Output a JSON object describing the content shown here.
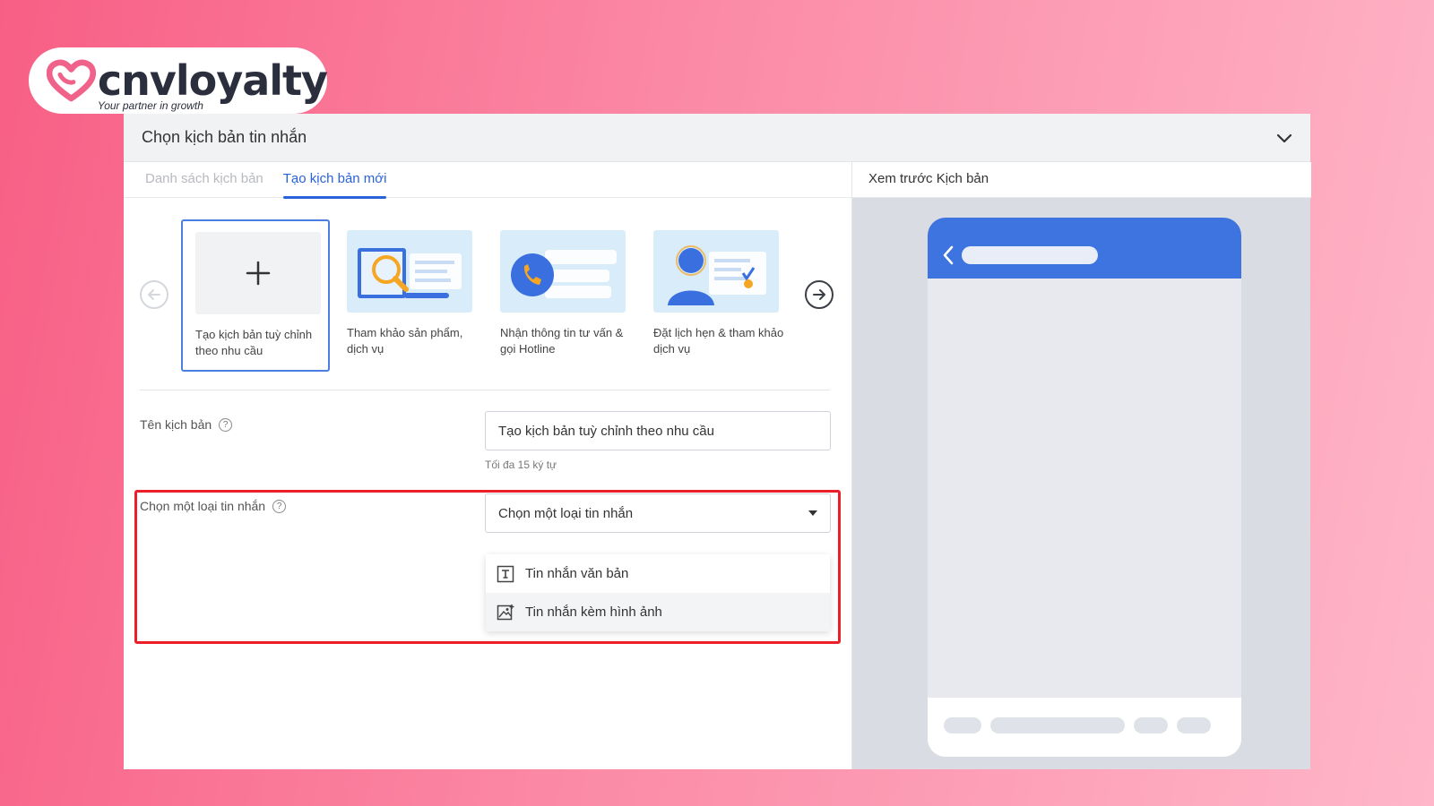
{
  "brand": {
    "name": "cnvloyalty",
    "tagline": "Your partner in growth",
    "accent": "#f0628a"
  },
  "panel": {
    "title": "Chọn kịch bản tin nhắn"
  },
  "tabs": [
    {
      "label": "Danh sách kịch bản",
      "active": false
    },
    {
      "label": "Tạo kịch bản mới",
      "active": true
    }
  ],
  "templates": [
    {
      "label": "Tạo kịch bản tuỳ chỉnh theo nhu cầu",
      "selected": true,
      "icon": "plus-icon"
    },
    {
      "label": "Tham khảo sản phẩm, dịch vụ",
      "selected": false,
      "icon": "magnifier-illustration"
    },
    {
      "label": "Nhận thông tin tư vấn & gọi Hotline",
      "selected": false,
      "icon": "phone-illustration"
    },
    {
      "label": "Đặt lịch hẹn & tham khảo dịch vụ",
      "selected": false,
      "icon": "person-illustration"
    }
  ],
  "form": {
    "name_label": "Tên kịch bản",
    "name_value": "Tạo kịch bản tuỳ chỉnh theo nhu cầu",
    "name_hint": "Tối đa 15 ký tự",
    "type_label": "Chọn một loại tin nhắn",
    "type_placeholder": "Chọn một loại tin nhắn",
    "type_options": [
      {
        "label": "Tin nhắn văn bản",
        "icon": "text-icon"
      },
      {
        "label": "Tin nhắn kèm hình ảnh",
        "icon": "image-icon"
      }
    ]
  },
  "preview": {
    "title": "Xem trước Kịch bản",
    "header_color": "#3e74e0"
  },
  "colors": {
    "primary": "#2a62d9",
    "highlight": "#ec1f28"
  }
}
